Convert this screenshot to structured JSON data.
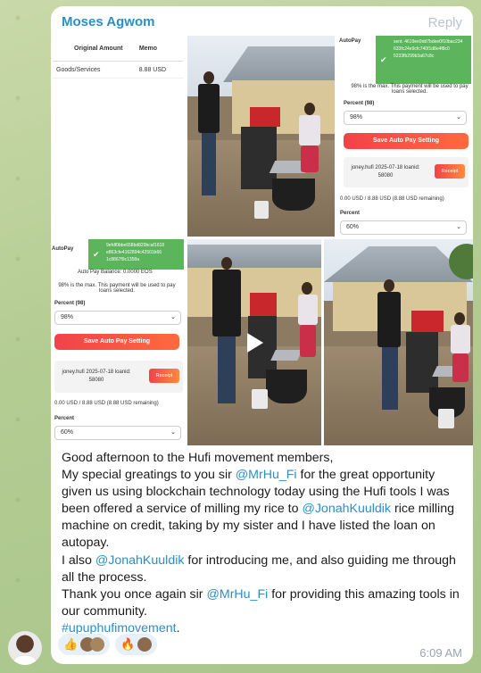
{
  "message": {
    "sender": "Moses Agwom",
    "reply_label": "Reply",
    "time": "6:09 AM",
    "text": {
      "l1": "Good afternoon to the Hufi movement members,",
      "l2a": "My special greatings to you sir ",
      "mention1": "@MrHu_Fi",
      "l2b": " for the great opportunity given us using blockchain technology today using the Hufi tools I was been offered a service of milling my rice to ",
      "mention2": "@JonahKuuldik",
      "l2c": " rice milling machine on credit, taking by my sister and I have listed the loan on autopay.",
      "l3a": "I also ",
      "mention3": "@JonahKuuldik",
      "l3b": " for introducing me, and also guiding me through all the process.",
      "l4a": "Thank you once again sir ",
      "mention4": "@MrHu_Fi",
      "l4b": " for providing this amazing tools in our community.",
      "hashtag": "#upuphufimovement",
      "l5": "."
    },
    "reactions": [
      {
        "emoji": "👍",
        "name": "thumbs-up"
      },
      {
        "emoji": "🔥",
        "name": "fire"
      }
    ]
  },
  "shot1": {
    "col_amount": "Original Amount",
    "col_memo": "Memo",
    "row_label": "Goods/Services",
    "row_value": "8.88 USD"
  },
  "shot2": {
    "autopay": "AutoPay",
    "toast": "sent. 4619ee9dd7bdee0f10bac234 633fc24e9cfc740f1d8e4f8c0 5233fb299b3a67c8c",
    "max_note": "98% is the max. This payment will be used to pay loans selected.",
    "percent_label": "Percent (98)",
    "percent_value": "98%",
    "save_button": "Save Auto Pay Setting",
    "loan": "joney.hufi 2025-07-18 loanid: 58080",
    "receipt": "Receipt",
    "remaining": "0.00 USD / 8.88 USD (8.88 USD remaining)",
    "percent2_label": "Percent",
    "percent2_value": "60%"
  },
  "shot3": {
    "autopay": "AutoPay",
    "toast": "9efdf0bbe658bd829bcaf1618 e863cfe4162894c42501b66 1c8867f9c1358a",
    "balance": "Auto Pay Balance: 0.0000 EOS",
    "max_note": "98% is the max. This payment will be used to pay loans selected.",
    "percent_label": "Percent (98)",
    "percent_value": "98%",
    "save_button": "Save Auto Pay Setting",
    "loan": "joney.hufi 2025-07-18 loanid: 58080",
    "receipt": "Receipt",
    "remaining": "0.00 USD / 8.88 USD (8.88 USD remaining)",
    "percent2_label": "Percent",
    "percent2_value": "60%"
  },
  "colors": {
    "accent": "#2a8fc7",
    "button_red": "#f2424a",
    "toast_green": "#5cb55c"
  }
}
